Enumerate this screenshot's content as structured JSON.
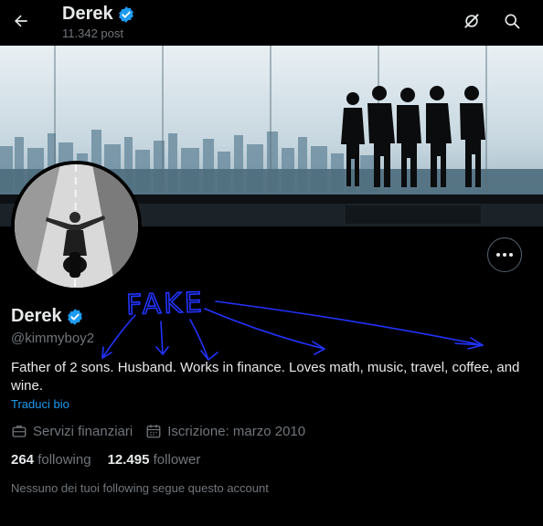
{
  "header": {
    "name": "Derek",
    "post_count": "11.342 post"
  },
  "profile": {
    "name": "Derek",
    "handle": "@kimmyboy2",
    "bio": "Father of 2 sons. Husband. Works in finance. Loves math, music, travel, coffee, and wine.",
    "translate_label": "Traduci bio",
    "category": "Servizi finanziari",
    "joined": "Iscrizione: marzo 2010",
    "following_count": "264",
    "following_label": "following",
    "follower_count": "12.495",
    "follower_label": "follower",
    "followed_by": "Nessuno dei tuoi following segue questo account"
  },
  "annotation": {
    "text": "FAKE",
    "color": "#2233ff"
  },
  "colors": {
    "background": "#000000",
    "text": "#e7e9ea",
    "muted": "#71767b",
    "accent": "#1d9bf0"
  },
  "icons": {
    "back": "arrow-left-icon",
    "verified": "verified-badge-icon",
    "grok": "grok-icon",
    "search": "search-icon",
    "more": "more-horizontal-icon",
    "category": "briefcase-icon",
    "calendar": "calendar-icon"
  }
}
